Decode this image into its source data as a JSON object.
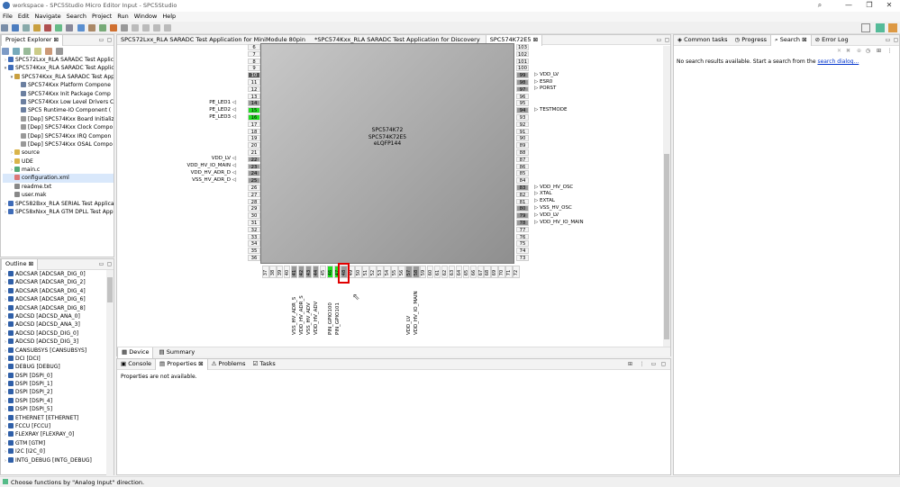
{
  "window": {
    "title": "workspace - SPC5Studio Micro Editor Input - SPC5Studio",
    "icon": "eclipse-icon"
  },
  "menu": [
    "File",
    "Edit",
    "Navigate",
    "Search",
    "Project",
    "Run",
    "Window",
    "Help"
  ],
  "project_explorer": {
    "tab": "Project Explorer",
    "items": [
      {
        "label": "SPC572Lxx_RLA SARADC Test Applica",
        "depth": 0,
        "expanded": false,
        "icon": "project-icon"
      },
      {
        "label": "SPC574Kxx_RLA SARADC Test Applica",
        "depth": 0,
        "expanded": true,
        "icon": "project-icon"
      },
      {
        "label": "SPC574Kxx_RLA SARADC Test App",
        "depth": 1,
        "expanded": true,
        "icon": "app-icon"
      },
      {
        "label": "SPC574Kxx Platform Compone",
        "depth": 2,
        "icon": "component-icon"
      },
      {
        "label": "SPC574Kxx Init Package Comp",
        "depth": 2,
        "icon": "component-icon"
      },
      {
        "label": "SPC574Kxx Low Level Drivers C",
        "depth": 2,
        "icon": "component-icon"
      },
      {
        "label": "SPC5 Runtime-IO Component (",
        "depth": 2,
        "icon": "component-icon"
      },
      {
        "label": "[Dep] SPC574Kxx Board Initializ",
        "depth": 2,
        "icon": "dep-icon"
      },
      {
        "label": "[Dep] SPC574Kxx Clock Compo",
        "depth": 2,
        "icon": "dep-icon"
      },
      {
        "label": "[Dep] SPC574Kxx IRQ Compon",
        "depth": 2,
        "icon": "dep-icon"
      },
      {
        "label": "[Dep] SPC574Kxx OSAL Compo",
        "depth": 2,
        "icon": "dep-icon"
      },
      {
        "label": "source",
        "depth": 1,
        "expanded": false,
        "icon": "folder-icon"
      },
      {
        "label": "UDE",
        "depth": 1,
        "expanded": false,
        "icon": "folder-icon"
      },
      {
        "label": "main.c",
        "depth": 1,
        "expanded": false,
        "icon": "c-file-icon"
      },
      {
        "label": "configuration.xml",
        "depth": 1,
        "icon": "xml-file-icon",
        "selected": true
      },
      {
        "label": "readme.txt",
        "depth": 1,
        "icon": "text-file-icon"
      },
      {
        "label": "user.mak",
        "depth": 1,
        "icon": "text-file-icon"
      },
      {
        "label": "SPC582Bxx_RLA SERIAL Test Applicati",
        "depth": 0,
        "expanded": false,
        "icon": "project-icon"
      },
      {
        "label": "SPC58xNxx_RLA GTM DPLL Test Appl",
        "depth": 0,
        "expanded": false,
        "icon": "project-icon"
      }
    ]
  },
  "outline": {
    "tab": "Outline",
    "items": [
      "ADCSAR [ADCSAR_DIG_0]",
      "ADCSAR [ADCSAR_DIG_2]",
      "ADCSAR [ADCSAR_DIG_4]",
      "ADCSAR [ADCSAR_DIG_6]",
      "ADCSAR [ADCSAR_DIG_8]",
      "ADCSD [ADCSD_ANA_0]",
      "ADCSD [ADCSD_ANA_3]",
      "ADCSD [ADCSD_DIG_0]",
      "ADCSD [ADCSD_DIG_3]",
      "CANSUBSYS [CANSUBSYS]",
      "DCI [DCI]",
      "DEBUG [DEBUG]",
      "DSPI [DSPI_0]",
      "DSPI [DSPI_1]",
      "DSPI [DSPI_2]",
      "DSPI [DSPI_4]",
      "DSPI [DSPI_5]",
      "ETHERNET [ETHERNET]",
      "FCCU [FCCU]",
      "FLEXRAY [FLEXRAY_0]",
      "GTM [GTM]",
      "I2C [I2C_0]",
      "INTG_DEBUG [INTG_DEBUG]"
    ]
  },
  "editor": {
    "tabs": [
      {
        "label": "SPC572Lxx_RLA SARADC Test Application for MiniModule 80pin",
        "active": false
      },
      {
        "label": "*SPC574Kxx_RLA SARADC Test Application for Discovery",
        "active": false
      },
      {
        "label": "SPC574K72E5",
        "active": true
      }
    ],
    "chip": {
      "name": "SPC574K72",
      "variant": "SPC574K72E5",
      "package": "eLQFP144"
    },
    "left_pins": [
      "6",
      "7",
      "8",
      "9",
      "10",
      "11",
      "12",
      "13",
      "14",
      "15",
      "16",
      "17",
      "18",
      "19",
      "20",
      "21",
      "22",
      "23",
      "24",
      "25",
      "26",
      "27",
      "28",
      "29",
      "30",
      "31",
      "32",
      "33",
      "34",
      "35",
      "36"
    ],
    "left_pin_styles": {
      "10": "dark",
      "14": "gray",
      "15": "green",
      "16": "green",
      "22": "gray",
      "23": "gray",
      "24": "gray",
      "25": "gray"
    },
    "left_signals": [
      {
        "pin": "14",
        "label": "PE_LED1"
      },
      {
        "pin": "15",
        "label": "PE_LED2"
      },
      {
        "pin": "16",
        "label": "PE_LED3"
      },
      {
        "pin": "22",
        "label": "VDD_LV"
      },
      {
        "pin": "23",
        "label": "VDD_HV_IO_MAIN"
      },
      {
        "pin": "24",
        "label": "VDD_HV_ADR_D"
      },
      {
        "pin": "25",
        "label": "VSS_HV_ADR_D"
      }
    ],
    "right_pins": [
      "103",
      "102",
      "101",
      "100",
      "99",
      "98",
      "97",
      "96",
      "95",
      "94",
      "93",
      "92",
      "91",
      "90",
      "89",
      "88",
      "87",
      "86",
      "85",
      "84",
      "83",
      "82",
      "81",
      "80",
      "79",
      "78",
      "77",
      "76",
      "75",
      "74",
      "73"
    ],
    "right_pin_styles": {
      "99": "gray",
      "98": "gray",
      "97": "gray",
      "94": "gray",
      "83": "gray",
      "80": "gray",
      "79": "gray",
      "78": "gray"
    },
    "right_signals": [
      {
        "pin": "99",
        "label": "VDD_LV"
      },
      {
        "pin": "98",
        "label": "ESR0"
      },
      {
        "pin": "97",
        "label": "PORST"
      },
      {
        "pin": "94",
        "label": "TESTMODE"
      },
      {
        "pin": "83",
        "label": "VDD_HV_OSC"
      },
      {
        "pin": "82",
        "label": "XTAL"
      },
      {
        "pin": "81",
        "label": "EXTAL"
      },
      {
        "pin": "80",
        "label": "VSS_HV_OSC"
      },
      {
        "pin": "79",
        "label": "VDD_LV"
      },
      {
        "pin": "78",
        "label": "VDD_HV_IO_MAIN"
      }
    ],
    "bottom_pins": [
      "37",
      "38",
      "39",
      "40",
      "41",
      "42",
      "43",
      "44",
      "45",
      "46",
      "47",
      "48",
      "49",
      "50",
      "51",
      "52",
      "53",
      "54",
      "55",
      "56",
      "57",
      "58",
      "59",
      "60",
      "61",
      "62",
      "63",
      "64",
      "65",
      "66",
      "67",
      "68",
      "69",
      "70",
      "71",
      "72"
    ],
    "bottom_pin_styles": {
      "41": "gray",
      "42": "gray",
      "43": "gray",
      "44": "gray",
      "46": "green",
      "47": "green",
      "48": "gray",
      "57": "gray",
      "58": "gray"
    },
    "bottom_signals": [
      {
        "pin": "41",
        "label": "VSS_HV_ADR_S"
      },
      {
        "pin": "42",
        "label": "VDD_HV_ADR_S"
      },
      {
        "pin": "43",
        "label": "VSS_HV_ADV"
      },
      {
        "pin": "44",
        "label": "VDD_HV_ADV"
      },
      {
        "pin": "46",
        "label": "PIN_GPIO100"
      },
      {
        "pin": "47",
        "label": "PIN_GPIO101"
      },
      {
        "pin": "57",
        "label": "VDD_LV"
      },
      {
        "pin": "58",
        "label": "VDD_HV_IO_MAIN"
      }
    ],
    "highlighted_pin": "48",
    "bottom_tabs": [
      "Device",
      "Summary"
    ]
  },
  "properties": {
    "tabs": [
      "Console",
      "Properties",
      "Problems",
      "Tasks"
    ],
    "active_tab": "Properties",
    "message": "Properties are not available."
  },
  "search": {
    "tabs": [
      "Common tasks",
      "Progress",
      "Search",
      "Error Log"
    ],
    "active_tab": "Search",
    "message": "No search results available. Start a search from the",
    "link": "search dialog...",
    "status_bar": "Choose functions by \"Analog Input\" direction."
  },
  "colors": {
    "pin_green": "#22dd22",
    "pin_gray": "#999999",
    "highlight_red": "#e00000",
    "link_blue": "#0033cc"
  }
}
